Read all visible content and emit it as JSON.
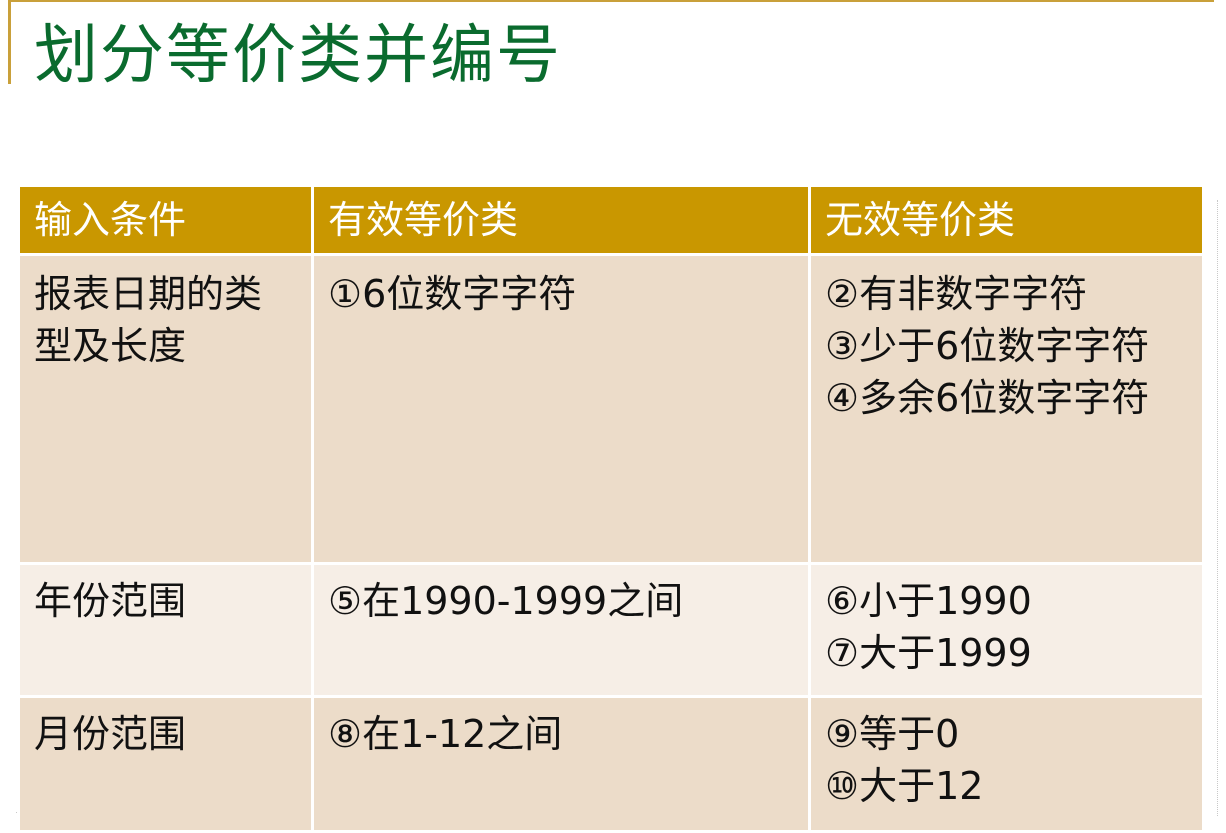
{
  "title": "划分等价类并编号",
  "table": {
    "headers": [
      "输入条件",
      "有效等价类",
      "无效等价类"
    ],
    "rows": [
      {
        "condition": "报表日期的类型及长度",
        "valid": [
          "①6位数字字符"
        ],
        "invalid": [
          "②有非数字字符",
          "③少于6位数字字符",
          "④多余6位数字字符"
        ]
      },
      {
        "condition": "年份范围",
        "valid": [
          "⑤在1990-1999之间"
        ],
        "invalid": [
          "⑥小于1990",
          "⑦大于1999"
        ]
      },
      {
        "condition": "月份范围",
        "valid": [
          "⑧在1-12之间"
        ],
        "invalid": [
          "⑨等于0",
          "⑩大于12"
        ]
      }
    ]
  },
  "colors": {
    "title": "#0a6b2e",
    "header_bg": "#c99700",
    "row_dark": "#ecdcc9",
    "row_light": "#f6eee6",
    "accent": "#c9a03a"
  }
}
